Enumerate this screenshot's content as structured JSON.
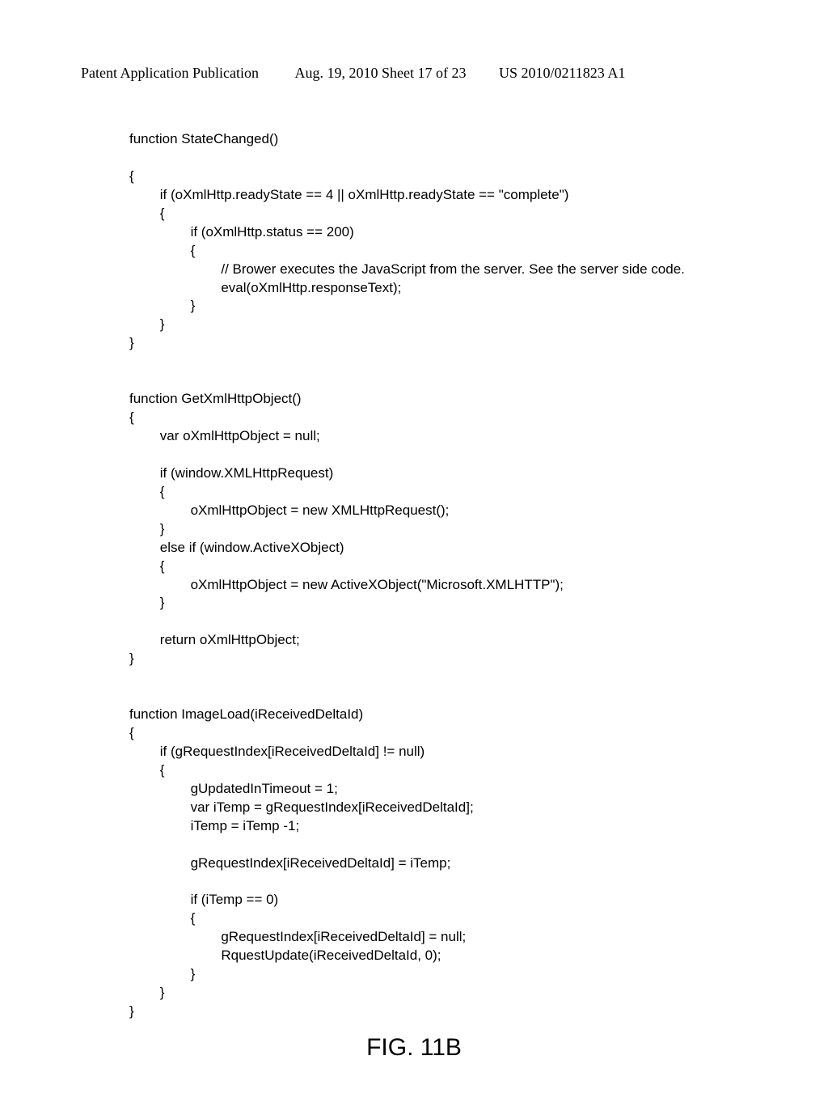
{
  "header": {
    "left": "Patent Application Publication",
    "mid": "Aug. 19, 2010  Sheet 17 of 23",
    "right": "US 2010/0211823 A1"
  },
  "code": "function StateChanged()\n\n{\n        if (oXmlHttp.readyState == 4 || oXmlHttp.readyState == \"complete\")\n        {\n                if (oXmlHttp.status == 200)\n                {\n                        // Brower executes the JavaScript from the server. See the server side code.\n                        eval(oXmlHttp.responseText);\n                }\n        }\n}\n\n\nfunction GetXmlHttpObject()\n{\n        var oXmlHttpObject = null;\n\n        if (window.XMLHttpRequest)\n        {\n                oXmlHttpObject = new XMLHttpRequest();\n        }\n        else if (window.ActiveXObject)\n        {\n                oXmlHttpObject = new ActiveXObject(\"Microsoft.XMLHTTP\");\n        }\n\n        return oXmlHttpObject;\n}\n\n\nfunction ImageLoad(iReceivedDeltaId)\n{\n        if (gRequestIndex[iReceivedDeltaId] != null)\n        {\n                gUpdatedInTimeout = 1;\n                var iTemp = gRequestIndex[iReceivedDeltaId];\n                iTemp = iTemp -1;\n\n                gRequestIndex[iReceivedDeltaId] = iTemp;\n\n                if (iTemp == 0)\n                {\n                        gRequestIndex[iReceivedDeltaId] = null;\n                        RquestUpdate(iReceivedDeltaId, 0);\n                }\n        }\n}",
  "figure_caption": "FIG. 11B"
}
